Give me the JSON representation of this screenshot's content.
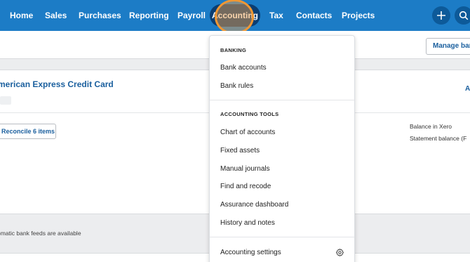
{
  "nav": {
    "items": [
      "Home",
      "Sales",
      "Purchases",
      "Reporting",
      "Payroll",
      "Accounting",
      "Tax",
      "Contacts",
      "Projects"
    ],
    "accent": "#1c7cc6",
    "active_bg": "#0b3e72",
    "highlight": "#f09733"
  },
  "header": {
    "add_icon": "plus-icon",
    "search_icon": "search-icon",
    "manage_button": "Manage bank"
  },
  "account": {
    "title": "merican Express Credit Card",
    "edge_link": "A",
    "reconcile_button": "Reconcile 6 items",
    "balance_labels": [
      "Balance in Xero",
      "Statement balance (F"
    ]
  },
  "notice": "omatic bank feeds are available",
  "dropdown": {
    "banking": {
      "heading": "BANKING",
      "items": [
        "Bank accounts",
        "Bank rules"
      ]
    },
    "tools": {
      "heading": "ACCOUNTING TOOLS",
      "items": [
        "Chart of accounts",
        "Fixed assets",
        "Manual journals",
        "Find and recode",
        "Assurance dashboard",
        "History and notes"
      ]
    },
    "settings": {
      "label": "Accounting settings",
      "icon": "gear-icon"
    }
  }
}
